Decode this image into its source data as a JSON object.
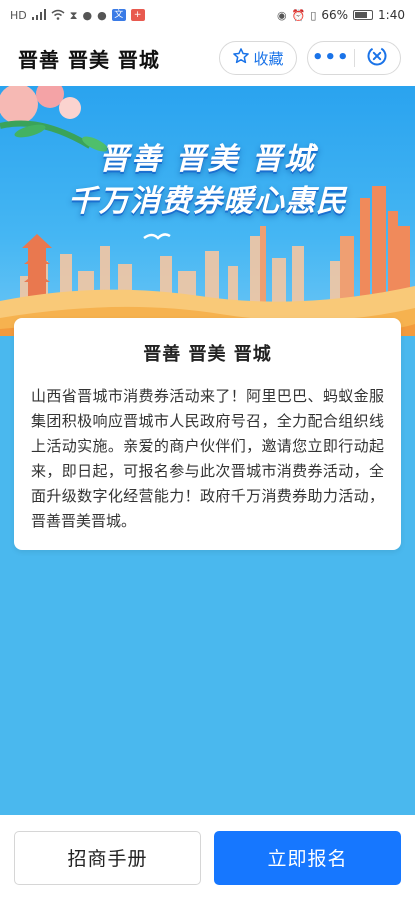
{
  "status_bar": {
    "left_icons": [
      "hd-icon",
      "signal-icon",
      "wifi-icon",
      "hourglass-icon",
      "shield-icon",
      "message-icon",
      "translate-icon",
      "plus-app-icon"
    ],
    "right_icons": [
      "eye-icon",
      "alarm-icon",
      "vibrate-icon"
    ],
    "battery": "66%",
    "time": "1:40"
  },
  "header": {
    "title": "晋善 晋美 晋城",
    "favorite_label": "收藏"
  },
  "banner": {
    "headline_1": "晋善 晋美 晋城",
    "headline_2": "千万消费券暖心惠民"
  },
  "card": {
    "title": "晋善 晋美 晋城",
    "body": "山西省晋城市消费券活动来了！阿里巴巴、蚂蚁金服集团积极响应晋城市人民政府号召，全力配合组织线上活动实施。亲爱的商户伙伴们，邀请您立即行动起来，即日起，可报名参与此次晋城市消费券活动，全面升级数字化经营能力！政府千万消费券助力活动，晋善晋美晋城。"
  },
  "bottom": {
    "handbook_label": "招商手册",
    "signup_label": "立即报名"
  },
  "colors": {
    "primary": "#1677ff",
    "page_bg": "#4ab8ee"
  }
}
